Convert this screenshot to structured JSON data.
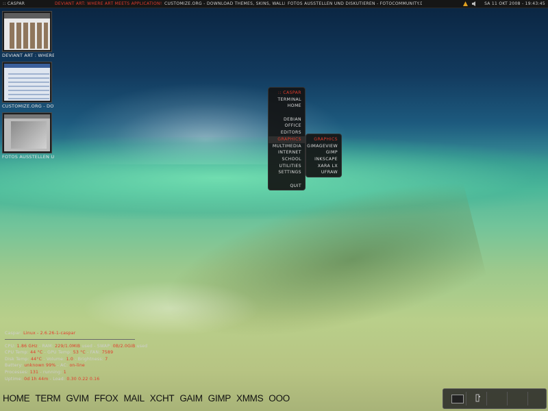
{
  "topbar": {
    "tasks": [
      ":: CASPAR",
      "DEVIANT ART: WHERE ART MEETS APPLICATION! - ICEWEASEL",
      "CUSTOMIZE.ORG - DOWNLOAD THEMES, SKINS, WALLPAPERS A",
      "FOTOS AUSSTELLEN UND DISKUTIEREN - FOTOCOMMUNITY.DE -"
    ],
    "clock": "SA 11 OKT 2008 - 19:43:45",
    "tray_icons": [
      "network-icon",
      "volume-icon"
    ],
    "accent": "#e23b2c"
  },
  "pager": {
    "windows": [
      {
        "label": "DEVIANT ART : WHERE ART"
      },
      {
        "label": "CUSTOMIZE.ORG - DOWNLO"
      },
      {
        "label": "FOTOS AUSSTELLEN UND D"
      }
    ]
  },
  "main_menu": {
    "title": ":: CASPAR",
    "items": [
      {
        "label": "TERMINAL"
      },
      {
        "label": "HOME"
      },
      {
        "label": ""
      },
      {
        "label": "DEBIAN"
      },
      {
        "label": "OFFICE"
      },
      {
        "label": "EDITORS"
      },
      {
        "label": "GRAPHICS"
      },
      {
        "label": "MULTIMEDIA"
      },
      {
        "label": "INTERNET"
      },
      {
        "label": "SCHOOL"
      },
      {
        "label": "UTILITIES"
      },
      {
        "label": "SETTINGS"
      },
      {
        "label": ""
      },
      {
        "label": "QUIT"
      }
    ]
  },
  "sub_menu": {
    "title": "GRAPHICS",
    "items": [
      {
        "label": "GIMAGEVIEW"
      },
      {
        "label": "GIMP"
      },
      {
        "label": "INKSCAPE"
      },
      {
        "label": "XARA LX"
      },
      {
        "label": "UFRAW"
      }
    ]
  },
  "conky": {
    "host_label": "Caspar:",
    "kernel": "Linux - 2.6.26-1-caspar",
    "cpu_label": "CPU:",
    "cpu": "1.86 GHz",
    "ram_label": "- RAM:",
    "ram": "229/1.0MiB",
    "swap_label": "used - SWAP:",
    "swap": "0B/2.0GiB",
    "swap_suffix": "used",
    "cputemp_label": "CPU Temp:",
    "cputemp": "44 °C",
    "gputemp_label": "- GPU Temp:",
    "gputemp": "53 °C",
    "fan_label": "- FAN:",
    "fan": "7589",
    "disk_label": "Disk Temp:",
    "disk": "44°C",
    "volume_label": "- Volume:",
    "volume": "1.0",
    "brightness_label": "- Brightness:",
    "brightness": "7",
    "battery_label": "Battery:",
    "battery": "unknown 99%",
    "ac_label": "- AC:",
    "ac": "on-line",
    "proc_label": "Processes:",
    "processes": "131",
    "running_label": "- running:",
    "running": "1",
    "uptime_label": "Uptime:",
    "uptime": "0d 1h 44m",
    "load_label": "- Load:",
    "load": "0.30 0.22 0.16"
  },
  "launcher": {
    "items": [
      "HOME",
      "TERM",
      "GVIM",
      "FFOX",
      "MAIL",
      "XCHT",
      "GAIM",
      "GIMP",
      "XMMS",
      "OOO"
    ]
  },
  "dock": {
    "slots": [
      "desktop-screen-icon",
      "app-icon",
      "",
      "",
      ""
    ]
  }
}
